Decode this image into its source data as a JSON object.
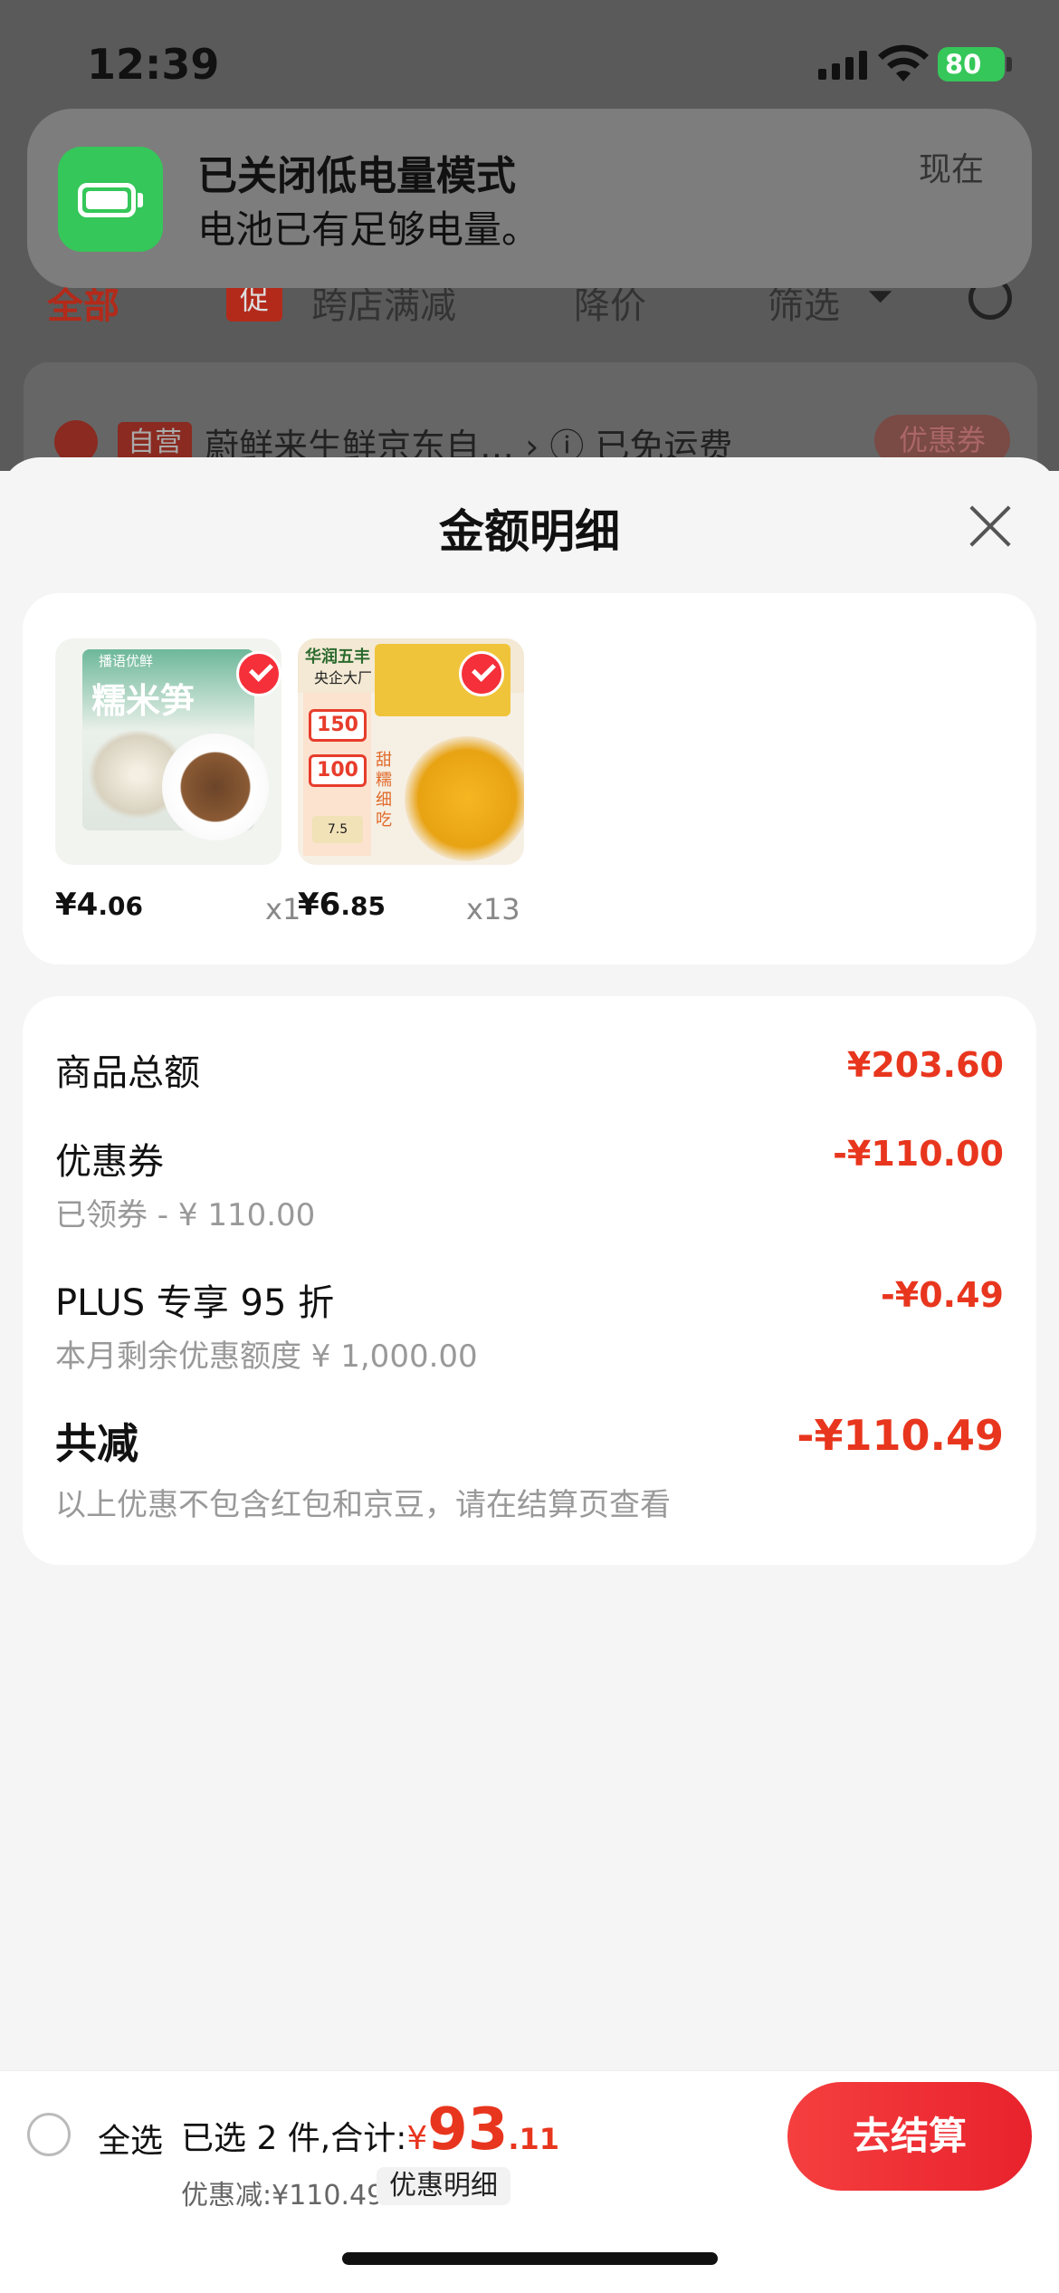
{
  "status_bar": {
    "time": "12:39",
    "battery": "80"
  },
  "notification": {
    "title": "已关闭低电量模式",
    "body": "电池已有足够电量。",
    "time": "现在"
  },
  "background": {
    "tabs": [
      "全部",
      "跨店满减",
      "降价",
      "筛选"
    ],
    "promo_badge": "促",
    "store": {
      "tag": "自营",
      "name": "蔚鲜来生鲜京东自…",
      "shipping": "已免运费",
      "coupon": "优惠券"
    }
  },
  "sheet": {
    "title": "金额明细",
    "products": [
      {
        "price_prefix": "¥4",
        "price_decimal": ".06",
        "qty": "x1",
        "image": {
          "brand": "播语优鲜",
          "title": "糯米笋"
        }
      },
      {
        "price_prefix": "¥6",
        "price_decimal": ".85",
        "qty": "x13",
        "image": {
          "brand": "华润五丰",
          "brand_sub": "央企大厂",
          "badge1": "150",
          "badge2": "100",
          "price_tag": "7.5",
          "side_text": "甜糯细吃"
        }
      }
    ],
    "summary": {
      "goods_total_label": "商品总额",
      "goods_total_value": "¥203.60",
      "coupon_label": "优惠券",
      "coupon_value": "-¥110.00",
      "coupon_sub": "已领券 - ¥ 110.00",
      "plus_label": "PLUS 专享 95 折",
      "plus_value": "-¥0.49",
      "plus_sub": "本月剩余优惠额度  ¥ 1,000.00",
      "total_reduce_label": "共减",
      "total_reduce_value": "-¥110.49",
      "note": "以上优惠不包含红包和京豆，请在结算页查看"
    }
  },
  "bottom_bar": {
    "select_all": "全选",
    "selected_text": "已选 2 件,合计:",
    "total_prefix": "¥",
    "total_int": "93",
    "total_decimal": ".11",
    "discount_text": "优惠减:¥110.49",
    "detail_button": "优惠明细",
    "checkout_button": "去结算"
  },
  "colors": {
    "accent": "#e8361e",
    "battery_green": "#35c759"
  }
}
